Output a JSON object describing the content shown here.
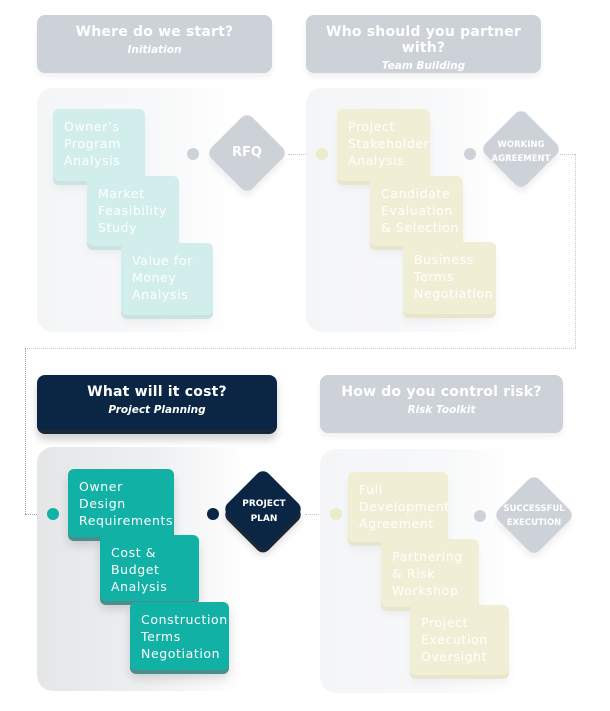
{
  "colors": {
    "navy": "#0b2645",
    "teal": "#12b1a5",
    "muted_gray": "#cdd2d9",
    "mint": "#d2eeec",
    "cream": "#f0efd6"
  },
  "phases": [
    {
      "question": "Where do we start?",
      "subtitle": "Initiation",
      "state": "inactive",
      "steps": [
        [
          "Owner’s",
          "Program",
          "Analysis"
        ],
        [
          "Market",
          "Feasibility",
          "Study"
        ],
        [
          "Value for",
          "Money",
          "Analysis"
        ]
      ],
      "milestone": [
        "RFQ"
      ]
    },
    {
      "question": "Who should you partner with?",
      "subtitle": "Team Building",
      "state": "inactive",
      "steps": [
        [
          "Project",
          "Stakeholder",
          "Analysis"
        ],
        [
          "Candidate",
          "Evaluation",
          "& Selection"
        ],
        [
          "Business",
          "Terms",
          "Negotiation"
        ]
      ],
      "milestone": [
        "WORKING",
        "AGREEMENT"
      ]
    },
    {
      "question": "What will it cost?",
      "subtitle": "Project Planning",
      "state": "active",
      "steps": [
        [
          "Owner",
          "Design",
          "Requirements"
        ],
        [
          "Cost &",
          "Budget",
          "Analysis"
        ],
        [
          "Construction",
          "Terms",
          "Negotiation"
        ]
      ],
      "milestone": [
        "PROJECT",
        "PLAN"
      ]
    },
    {
      "question": "How do you control risk?",
      "subtitle": "Risk Toolkit",
      "state": "inactive",
      "steps": [
        [
          "Full",
          "Development",
          "Agreement"
        ],
        [
          "Partnering",
          "& Risk",
          "Workshop"
        ],
        [
          "Project",
          "Execution",
          "Oversight"
        ]
      ],
      "milestone": [
        "SUCCESSFUL",
        "EXECUTION"
      ]
    }
  ]
}
